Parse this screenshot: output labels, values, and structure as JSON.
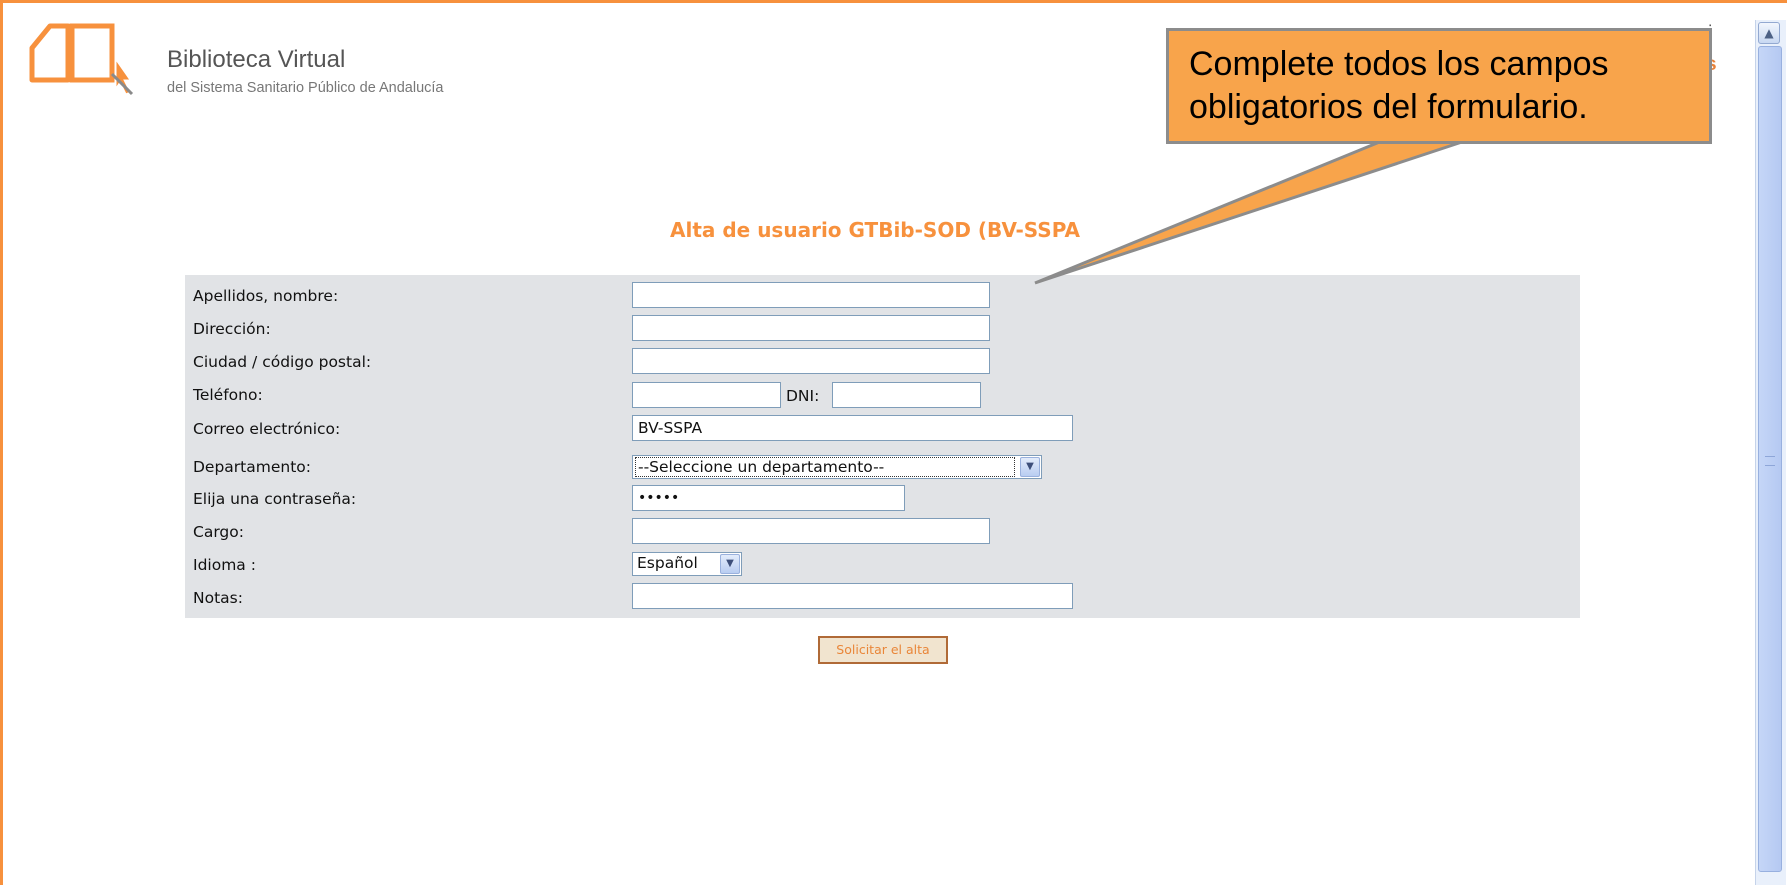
{
  "logo": {
    "title": "Biblioteca Virtual",
    "subtitle": "del Sistema Sanitario Público de Andalucía"
  },
  "top_right_fragments": {
    "colon": ":",
    "letter": "s"
  },
  "callout": {
    "line1": "Complete todos los campos",
    "line2": "obligatorios del formulario."
  },
  "page_title": "Alta de usuario GTBib-SOD (BV-SSPA",
  "form": {
    "fields": [
      {
        "label": "Apellidos, nombre:",
        "value": ""
      },
      {
        "label": "Dirección:",
        "value": ""
      },
      {
        "label": "Ciudad / código postal:",
        "value": ""
      },
      {
        "label": "Teléfono:",
        "value": ""
      },
      {
        "label": "Correo electrónico:",
        "value": "BV-SSPA"
      },
      {
        "label": "Departamento:",
        "value": "--Seleccione un departamento--"
      },
      {
        "label": "Elija una contraseña:",
        "value": "•••••"
      },
      {
        "label": "Cargo:",
        "value": ""
      },
      {
        "label": "Idioma :",
        "value": "Español"
      },
      {
        "label": "Notas:",
        "value": ""
      }
    ],
    "dni_label": "DNI:",
    "dni_value": "",
    "submit_label": "Solicitar el alta"
  },
  "colors": {
    "accent": "#f7913d",
    "callout_bg": "#f8a44b",
    "panel_bg": "#e1e3e6"
  },
  "icons": [
    "logo-book-cursor-icon",
    "chevron-down-icon",
    "scroll-up-arrow-icon"
  ]
}
